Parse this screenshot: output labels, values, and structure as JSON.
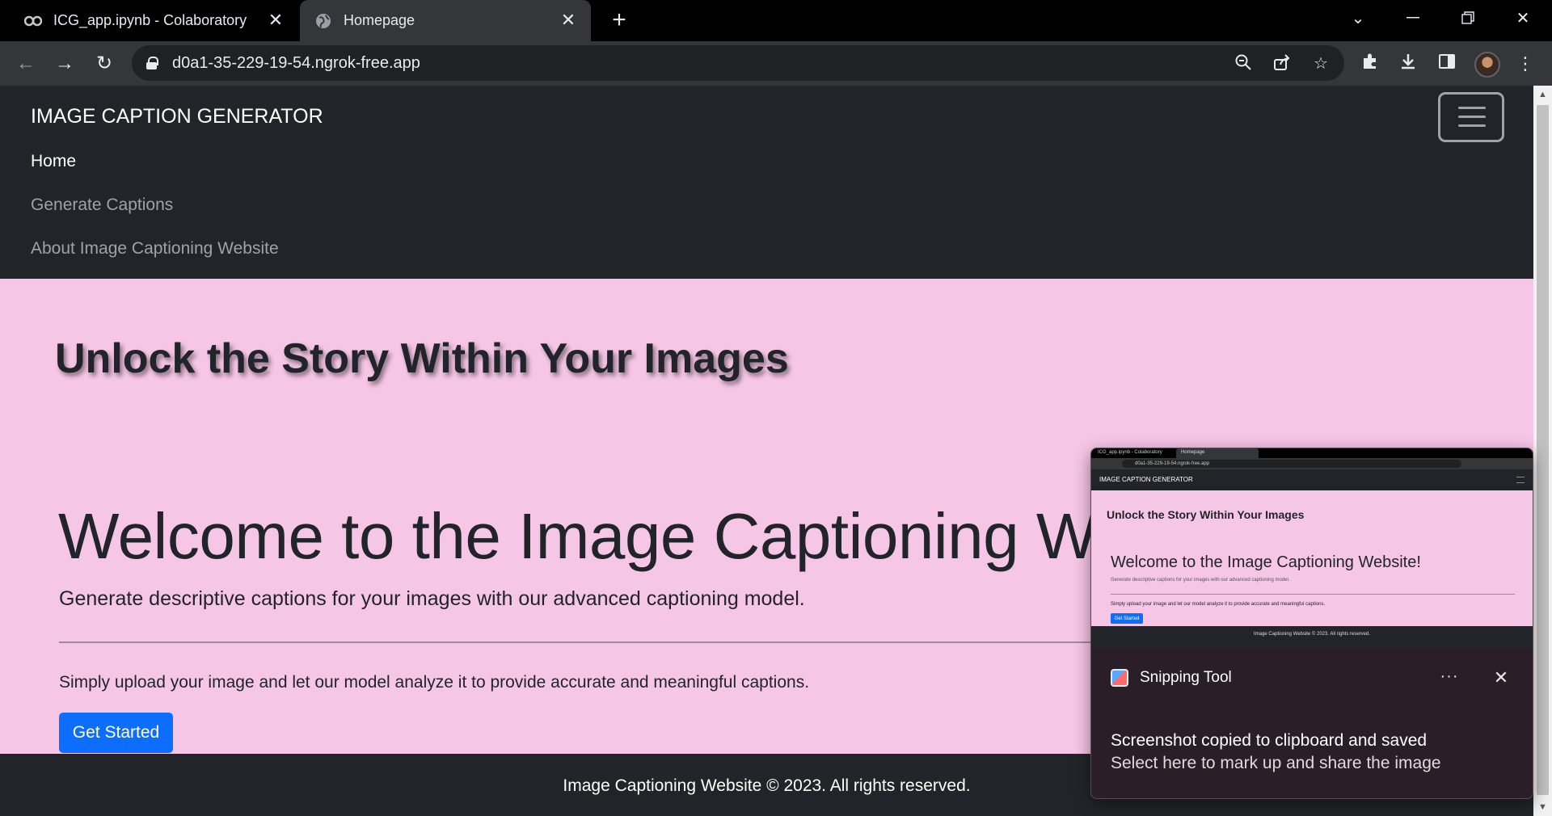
{
  "browser": {
    "tabs": [
      {
        "title": "ICG_app.ipynb - Colaboratory",
        "favicon": "colab-icon",
        "active": false
      },
      {
        "title": "Homepage",
        "favicon": "globe-icon",
        "active": true
      }
    ],
    "url": "d0a1-35-229-19-54.ngrok-free.app"
  },
  "navbar": {
    "brand": "IMAGE CAPTION GENERATOR",
    "links": [
      {
        "label": "Home",
        "active": true
      },
      {
        "label": "Generate Captions",
        "active": false
      },
      {
        "label": "About Image Captioning Website",
        "active": false
      }
    ]
  },
  "hero": {
    "title": "Unlock the Story Within Your Images"
  },
  "jumbotron": {
    "heading": "Welcome to the Image Captioning Website!",
    "lead": "Generate descriptive captions for your images with our advanced captioning model.",
    "body": "Simply upload your image and let our model analyze it to provide accurate and meaningful captions.",
    "button_label": "Get Started"
  },
  "footer": {
    "text": "Image Captioning Website © 2023. All rights reserved."
  },
  "toast": {
    "app_name": "Snipping Tool",
    "line1": "Screenshot copied to clipboard and saved",
    "line2": "Select here to mark up and share the image",
    "more_label": "···",
    "close_label": "✕"
  },
  "colors": {
    "page_bg": "#f6c6e6",
    "navbar_bg": "#212529",
    "primary": "#0d6efd",
    "toast_bg": "#2a1f28"
  }
}
